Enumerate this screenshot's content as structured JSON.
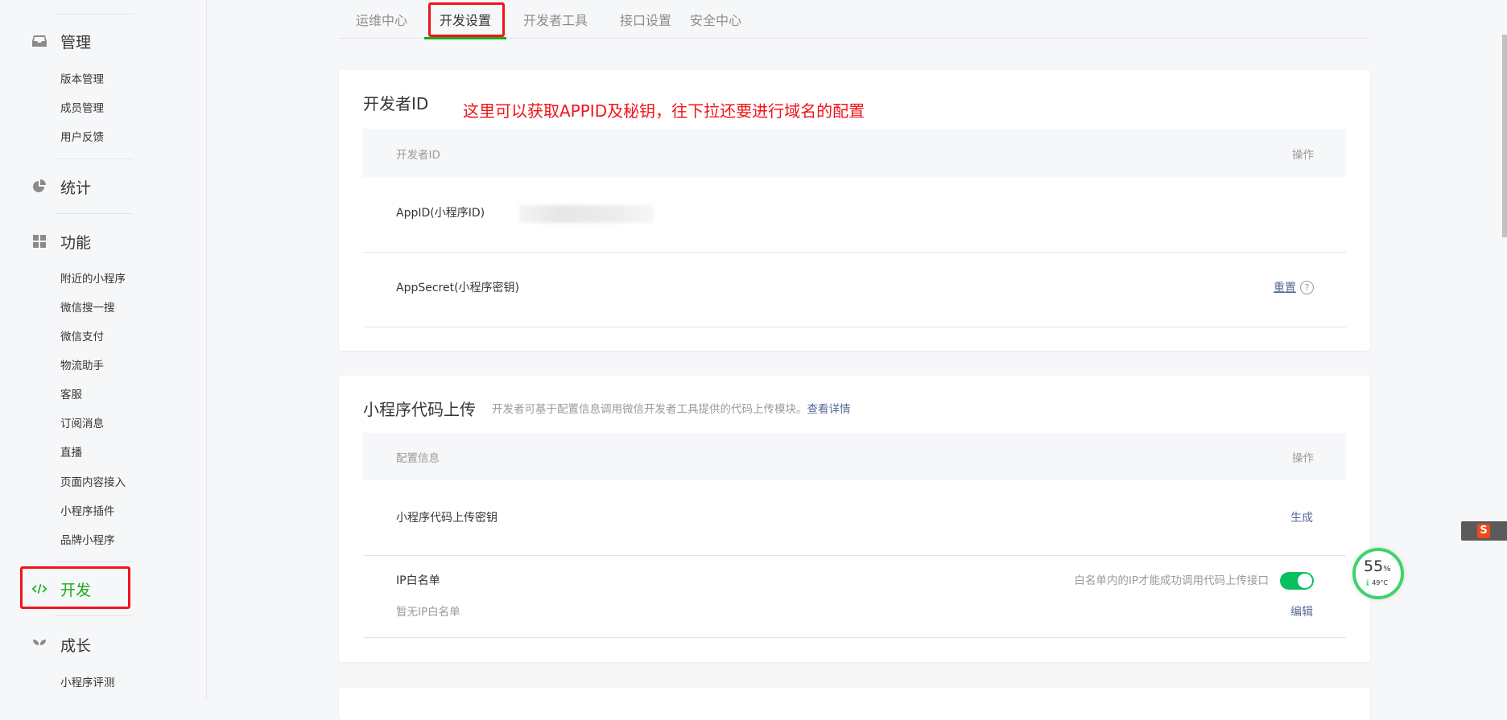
{
  "sidebar": {
    "sections": [
      {
        "label": "管理",
        "icon": "inbox-icon",
        "items": [
          "版本管理",
          "成员管理",
          "用户反馈"
        ]
      },
      {
        "label": "统计",
        "icon": "pie-chart-icon",
        "items": []
      },
      {
        "label": "功能",
        "icon": "grid-icon",
        "items": [
          "附近的小程序",
          "微信搜一搜",
          "微信支付",
          "物流助手",
          "客服",
          "订阅消息",
          "直播",
          "页面内容接入",
          "小程序插件",
          "品牌小程序"
        ]
      },
      {
        "label": "开发",
        "icon": "code-icon",
        "items": [],
        "active": true
      },
      {
        "label": "成长",
        "icon": "sprout-icon",
        "items": [
          "小程序评测"
        ]
      }
    ]
  },
  "tabs": [
    {
      "label": "运维中心"
    },
    {
      "label": "开发设置",
      "active": true
    },
    {
      "label": "开发者工具"
    },
    {
      "label": "接口设置"
    },
    {
      "label": "安全中心"
    }
  ],
  "developer_id": {
    "title": "开发者ID",
    "annotation": "这里可以获取APPID及秘钥，往下拉还要进行域名的配置",
    "header": {
      "col1": "开发者ID",
      "col2": "操作"
    },
    "rows": [
      {
        "label": "AppID(小程序ID)"
      },
      {
        "label": "AppSecret(小程序密钥)",
        "action": "重置"
      }
    ]
  },
  "code_upload": {
    "title": "小程序代码上传",
    "description": "开发者可基于配置信息调用微信开发者工具提供的代码上传模块。",
    "details_link": "查看详情",
    "header": {
      "col1": "配置信息",
      "col2": "操作"
    },
    "rows": [
      {
        "label": "小程序代码上传密钥",
        "action": "生成"
      },
      {
        "label": "IP白名单",
        "hint": "白名单内的IP才能成功调用代码上传接口",
        "toggle_on": true,
        "sub": "暂无IP白名单",
        "action": "编辑"
      }
    ]
  },
  "widget": {
    "percent": "55",
    "percent_sign": "%",
    "temp": "49°C"
  },
  "colors": {
    "accent": "#07c160",
    "link": "#576b95",
    "annotation": "#f2141a"
  }
}
